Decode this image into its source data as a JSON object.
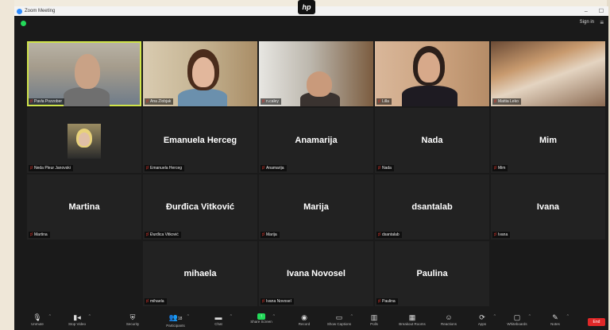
{
  "window": {
    "title": "Zoom Meeting"
  },
  "titlebar": {
    "minimize": "–",
    "maximize": "☐"
  },
  "brand": {
    "laptop_logo": "hp"
  },
  "header": {
    "sign_in": "Sign in",
    "menu_icon": "hamburger-icon"
  },
  "participants": [
    {
      "name": "Pavla Pozzober",
      "video": true,
      "active_speaker": true
    },
    {
      "name": "Ana Zlobjak",
      "video": true
    },
    {
      "name": "n.caley",
      "video": true
    },
    {
      "name": "Lilla",
      "video": true
    },
    {
      "name": "Mattia Leko",
      "video": true
    },
    {
      "name": "Neda Pleur Janovski",
      "video": true,
      "display": ""
    },
    {
      "name": "Emanuela Herceg",
      "display": "Emanuela Herceg"
    },
    {
      "name": "Anamarija",
      "display": "Anamarija"
    },
    {
      "name": "Nada",
      "display": "Nada"
    },
    {
      "name": "Mim",
      "display": "Mim"
    },
    {
      "name": "Martina",
      "display": "Martina"
    },
    {
      "name": "Đurđica Vitković",
      "display": "Đurđica Vitković"
    },
    {
      "name": "Marija",
      "display": "Marija"
    },
    {
      "name": "dsantalab",
      "display": "dsantalab"
    },
    {
      "name": "Ivana",
      "display": "Ivana"
    },
    {
      "name": "mihaela",
      "display": "mihaela"
    },
    {
      "name": "Ivana Novosel",
      "display": "Ivana Novosel"
    },
    {
      "name": "Paulina",
      "display": "Paulina"
    }
  ],
  "toolbar": {
    "items": [
      {
        "label": "Unmute",
        "icon": "microphone-off-icon"
      },
      {
        "label": "Stop Video",
        "icon": "video-camera-icon"
      },
      {
        "label": "Security",
        "icon": "shield-icon"
      },
      {
        "label": "Participants",
        "icon": "participants-icon",
        "count": "18"
      },
      {
        "label": "Chat",
        "icon": "chat-icon"
      },
      {
        "label": "Share Screen",
        "icon": "share-screen-icon"
      },
      {
        "label": "Record",
        "icon": "record-icon"
      },
      {
        "label": "Show Captions",
        "icon": "captions-icon"
      },
      {
        "label": "Polls",
        "icon": "polls-icon"
      },
      {
        "label": "Breakout Rooms",
        "icon": "breakout-rooms-icon"
      },
      {
        "label": "Reactions",
        "icon": "reactions-icon"
      },
      {
        "label": "Apps",
        "icon": "apps-icon"
      },
      {
        "label": "Whiteboards",
        "icon": "whiteboard-icon"
      },
      {
        "label": "Notes",
        "icon": "notes-icon"
      }
    ],
    "end_label": "End"
  },
  "colors": {
    "accent_green": "#23d959",
    "speaker_outline": "#cfe34a",
    "end_red": "#e02828"
  }
}
